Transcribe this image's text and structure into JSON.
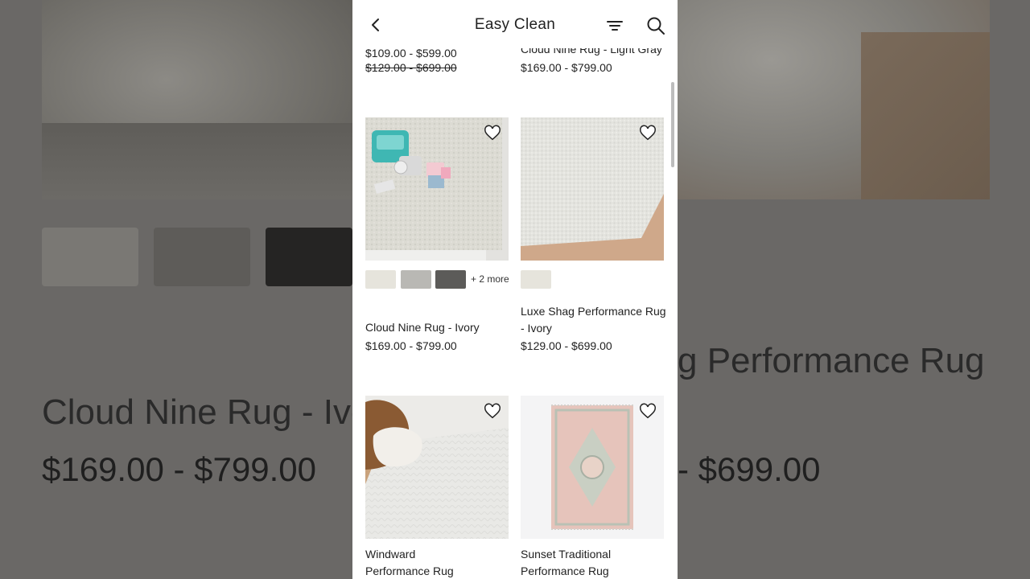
{
  "header": {
    "title": "Easy Clean"
  },
  "icons": {
    "back": "chevron-left-icon",
    "filter": "filter-icon",
    "search": "search-icon",
    "favorite": "heart-icon"
  },
  "products": [
    {
      "name": "",
      "price": "$109.00 - $599.00",
      "original_price": "$129.00 - $699.00"
    },
    {
      "name": "Cloud Nine Rug - Light Gray",
      "price": "$169.00 - $799.00"
    },
    {
      "name": "Cloud Nine Rug - Ivory",
      "price": "$169.00 - $799.00",
      "more_swatches": "+ 2 more"
    },
    {
      "name_line1": "Luxe Shag Performance Rug",
      "name_line2": "- Ivory",
      "price": "$129.00 - $699.00"
    },
    {
      "name_line1": "Windward",
      "name_line2": "Performance Rug"
    },
    {
      "name_line1": "Sunset Traditional",
      "name_line2": "Performance Rug"
    }
  ],
  "background": {
    "title_left": "Cloud Nine Rug - Ivory",
    "price_left": "$169.00 - $799.00",
    "title_right": "g Performance Rug",
    "price_right": "- $699.00"
  },
  "colors": {
    "sale_price": "#a3173f",
    "text": "#222222"
  }
}
